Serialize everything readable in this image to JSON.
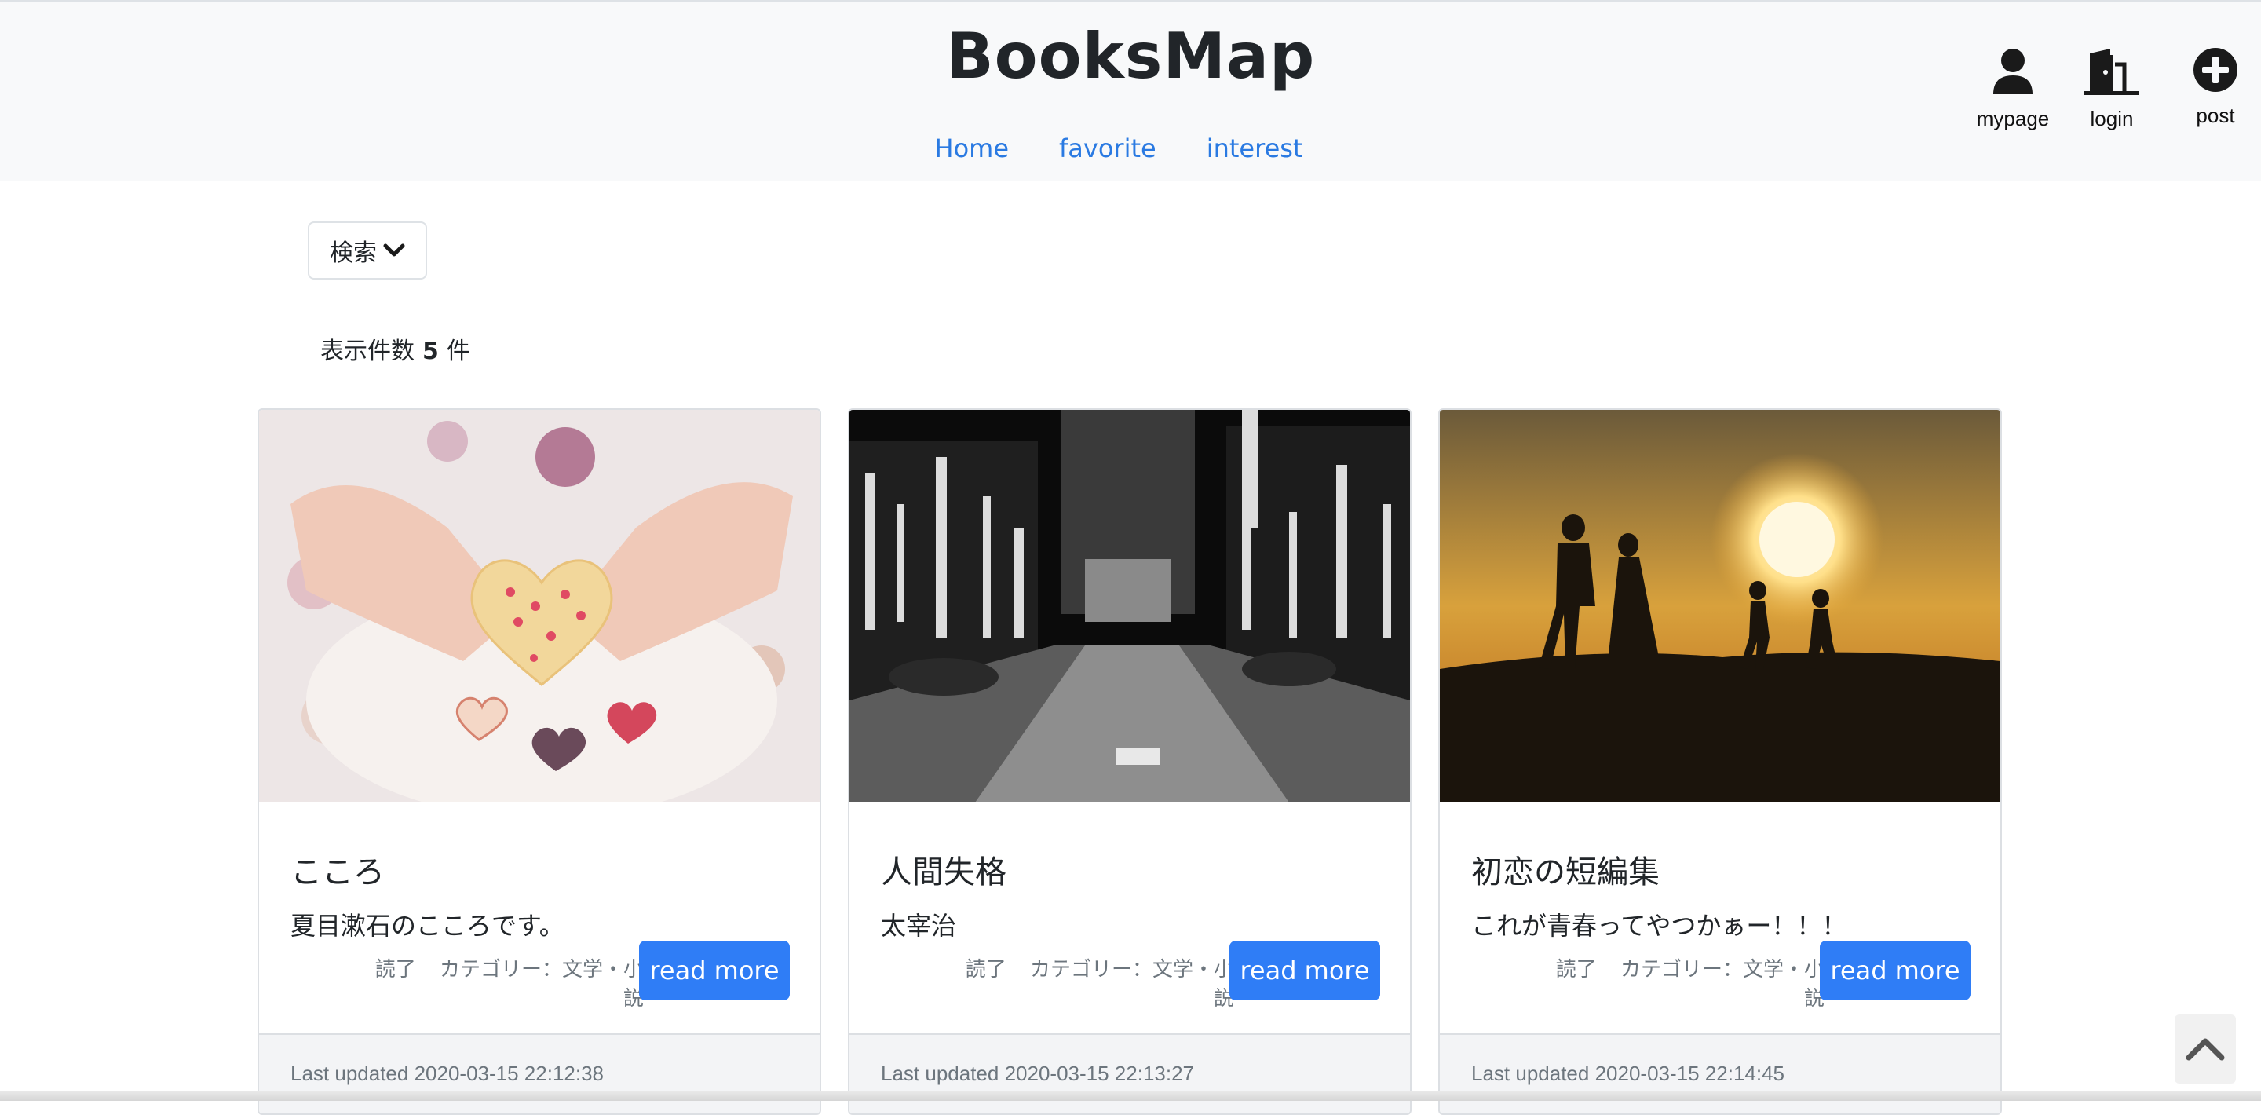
{
  "header": {
    "brand": "BooksMap",
    "nav": [
      "Home",
      "favorite",
      "interest"
    ],
    "actions": {
      "mypage": "mypage",
      "login": "login",
      "post": "post"
    }
  },
  "search": {
    "label": "検索"
  },
  "count": {
    "prefix": "表示件数",
    "value": "5",
    "suffix": "件"
  },
  "colors": {
    "accent": "#2f7df6",
    "link": "#2a7ae2",
    "header_bg": "#f8f9fa"
  },
  "cards": [
    {
      "title": "こころ",
      "description": "夏目漱石のこころです。",
      "status": "読了",
      "category": "カテゴリー：文学・小説",
      "button": "read more",
      "updated": "Last updated 2020-03-15 22:12:38",
      "image": "hands-holding-heart-cookie"
    },
    {
      "title": "人間失格",
      "description": "太宰治",
      "status": "読了",
      "category": "カテゴリー：文学・小説",
      "button": "read more",
      "updated": "Last updated 2020-03-15 22:13:27",
      "image": "night-city-street-monochrome"
    },
    {
      "title": "初恋の短編集",
      "description": "これが青春ってやつかぁー！！！",
      "status": "読了",
      "category": "カテゴリー：文学・小説",
      "button": "read more",
      "updated": "Last updated 2020-03-15 22:14:45",
      "image": "sunset-silhouettes"
    }
  ]
}
